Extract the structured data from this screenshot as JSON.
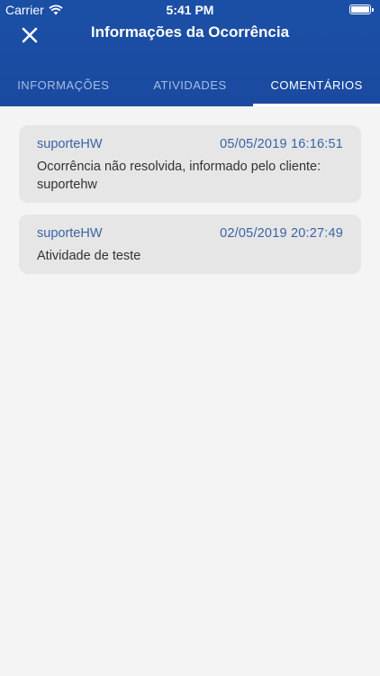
{
  "status_bar": {
    "carrier": "Carrier",
    "time": "5:41 PM"
  },
  "nav": {
    "title": "Informações da Ocorrência"
  },
  "tabs": [
    {
      "label": "INFORMAÇÕES"
    },
    {
      "label": "ATIVIDADES"
    },
    {
      "label": "COMENTÁRIOS"
    }
  ],
  "comments": [
    {
      "author": "suporteHW",
      "date": "05/05/2019 16:16:51",
      "text": "Ocorrência não resolvida, informado pelo cliente: suportehw"
    },
    {
      "author": "suporteHW",
      "date": "02/05/2019 20:27:49",
      "text": "Atividade de teste"
    }
  ],
  "colors": {
    "header": "#1b4fa6",
    "background": "#f4f4f4",
    "card": "#e6e6e6",
    "accent_text": "#3a63a8"
  },
  "icons": {
    "close": "close-icon",
    "wifi": "wifi-icon",
    "battery": "battery-icon"
  }
}
